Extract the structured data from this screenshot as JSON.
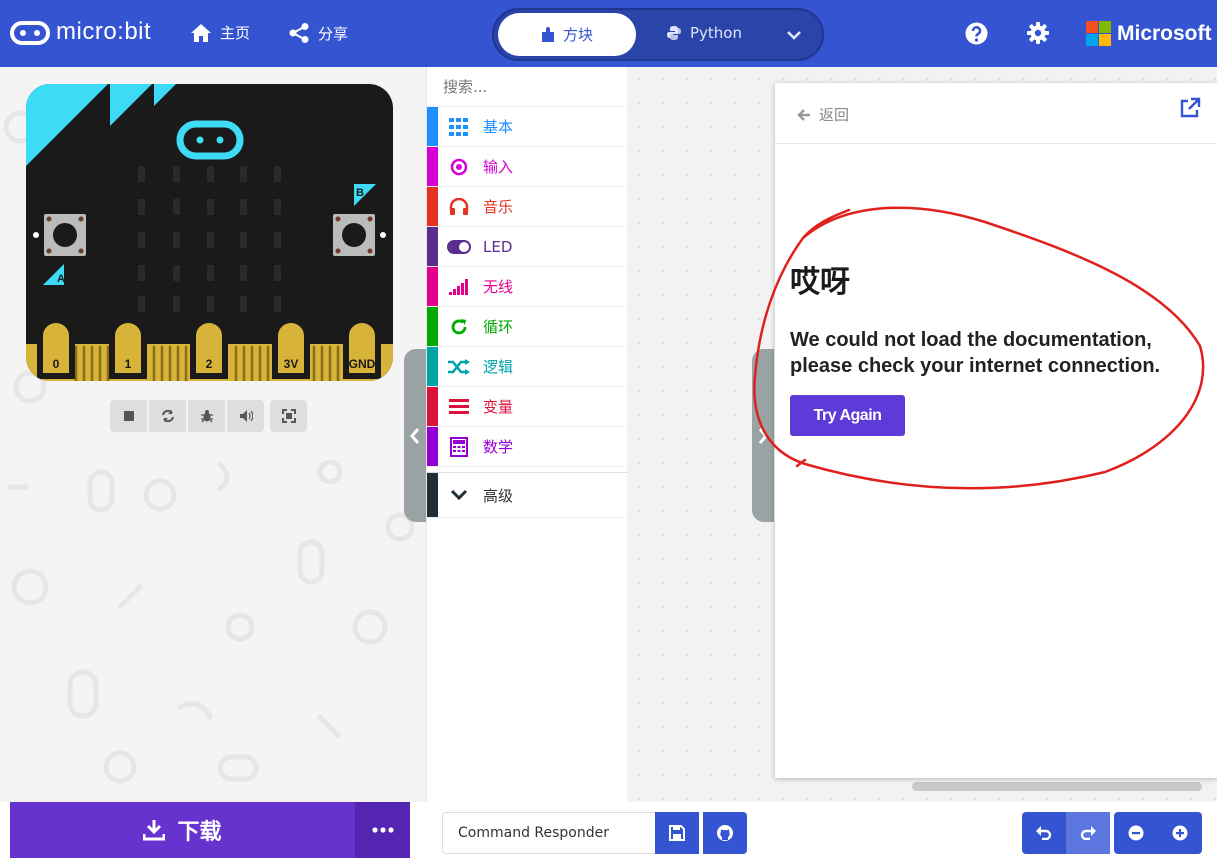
{
  "header": {
    "logo_text": "micro:bit",
    "home_label": "主页",
    "share_label": "分享",
    "blocks_label": "方块",
    "python_label": "Python",
    "brand": "Microsoft"
  },
  "simulator": {
    "pins": [
      "0",
      "1",
      "2",
      "3V",
      "GND"
    ],
    "button_a": "A",
    "button_b": "B"
  },
  "toolbox": {
    "search_placeholder": "搜索...",
    "categories": [
      {
        "label": "基本",
        "color": "#1e90ff",
        "icon": "grid-icon"
      },
      {
        "label": "输入",
        "color": "#d400d4",
        "icon": "radio-target-icon"
      },
      {
        "label": "音乐",
        "color": "#e63022",
        "icon": "headphones-icon"
      },
      {
        "label": "LED",
        "color": "#5c2d91",
        "icon": "toggle-icon"
      },
      {
        "label": "无线",
        "color": "#e3008c",
        "icon": "signal-bars-icon"
      },
      {
        "label": "循环",
        "color": "#00aa00",
        "icon": "refresh-icon"
      },
      {
        "label": "逻辑",
        "color": "#00a4a6",
        "icon": "shuffle-icon"
      },
      {
        "label": "变量",
        "color": "#dc143c",
        "icon": "lines-icon"
      },
      {
        "label": "数学",
        "color": "#9400d3",
        "icon": "calculator-icon"
      }
    ],
    "advanced_label": "高级"
  },
  "docs": {
    "back_label": "返回",
    "error_title": "哎呀",
    "error_message": "We could not load the documentation, please check your internet connection.",
    "retry_label": "Try Again"
  },
  "bottom": {
    "download_label": "下载",
    "project_name": "Command Responder"
  },
  "colors": {
    "header": "#3454d1",
    "download": "#6733cf",
    "retry": "#5e3bd9",
    "annotation": "#e0201c"
  }
}
